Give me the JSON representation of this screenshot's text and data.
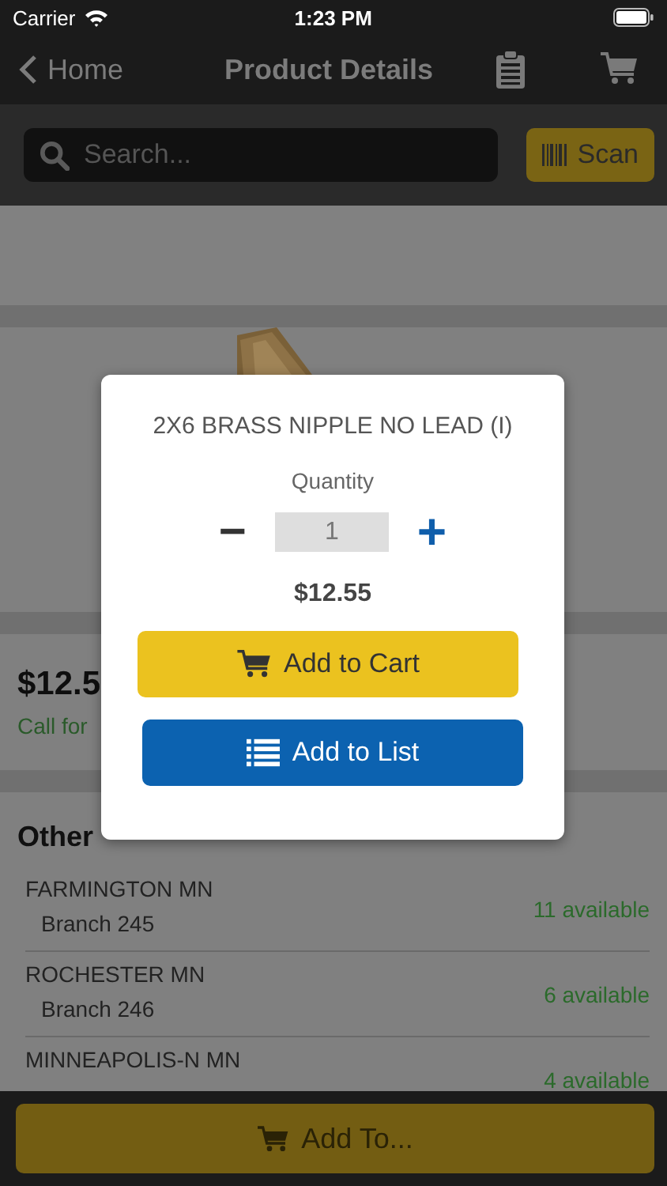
{
  "status_bar": {
    "carrier": "Carrier",
    "time": "1:23 PM"
  },
  "nav": {
    "back": "Home",
    "title": "Product Details"
  },
  "search": {
    "placeholder": "Search...",
    "scan": "Scan"
  },
  "product": {
    "price": "$12.5",
    "note": "Call for"
  },
  "availability": {
    "heading": "Other",
    "branches": [
      {
        "name": "FARMINGTON MN",
        "branch": "Branch 245",
        "available": "11 available"
      },
      {
        "name": "ROCHESTER MN",
        "branch": "Branch 246",
        "available": "6 available"
      },
      {
        "name": "MINNEAPOLIS-N MN",
        "available": "4 available"
      }
    ]
  },
  "footer": {
    "button": "Add To..."
  },
  "dialog": {
    "title": "2X6 BRASS NIPPLE NO LEAD (I)",
    "quantity_label": "Quantity",
    "minus": "−",
    "quantity": "1",
    "plus": "+",
    "price": "$12.55",
    "buttons": [
      {
        "kind": "cart",
        "label": "Add to Cart"
      },
      {
        "kind": "list",
        "label": "Add to List"
      }
    ]
  }
}
